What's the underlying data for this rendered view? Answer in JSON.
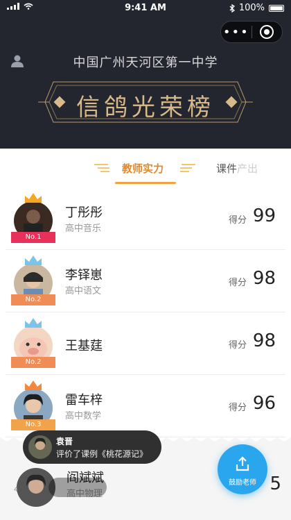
{
  "status_bar": {
    "time": "9:41 AM",
    "battery": "100%"
  },
  "header": {
    "school": "中国广州天河区第一中学",
    "title": "信鸽光荣榜"
  },
  "tabs": {
    "active": "教师实力",
    "other": "课件",
    "other_faded": "产出"
  },
  "teachers": [
    {
      "name": "丁彤彤",
      "subject": "高中音乐",
      "score_label": "得分",
      "score": "99",
      "rank": "No.1",
      "rank_color": "#e8315a",
      "crown_color": "#f5a623"
    },
    {
      "name": "李铎崽",
      "subject": "高中语文",
      "score_label": "得分",
      "score": "98",
      "rank": "No.2",
      "rank_color": "#f08c56",
      "crown_color": "#7cc3ea"
    },
    {
      "name": "王基莛",
      "subject": "",
      "score_label": "得分",
      "score": "98",
      "rank": "No.2",
      "rank_color": "#f08c56",
      "crown_color": "#7cc3ea"
    },
    {
      "name": "雷车梓",
      "subject": "高中数学",
      "score_label": "得分",
      "score": "96",
      "rank": "No.3",
      "rank_color": "#f2a24a",
      "crown_color": "#f3883a"
    }
  ],
  "bottom_row": {
    "name": "阎斌斌",
    "subject": "高中物理",
    "score": "5",
    "rank": "4"
  },
  "toast": {
    "name": "袁晋",
    "message": "评价了课例《桃花源记》"
  },
  "fab": {
    "label": "鼓励老师"
  },
  "colors": {
    "header_bg": "#23262e",
    "gold": "#d8b98a",
    "accent": "#e0892a",
    "fab": "#2aa6ee"
  }
}
